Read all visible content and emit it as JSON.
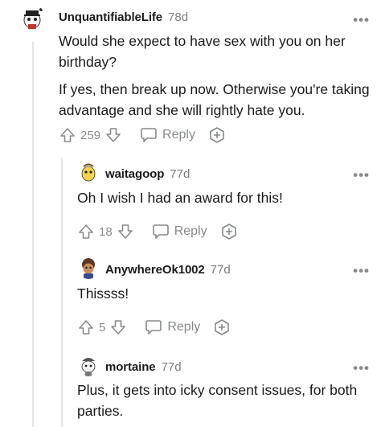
{
  "comments": [
    {
      "username": "UnquantifiableLife",
      "age": "78d",
      "paragraphs": [
        "Would she expect to have sex with you on her birthday?",
        "If yes, then break up now. Otherwise you're taking advantage and she will rightly hate you."
      ],
      "score": "259",
      "reply_label": "Reply",
      "more_label": "•••"
    },
    {
      "username": "waitagoop",
      "age": "77d",
      "paragraphs": [
        "Oh I wish I had an award for this!"
      ],
      "score": "18",
      "reply_label": "Reply",
      "more_label": "•••"
    },
    {
      "username": "AnywhereOk1002",
      "age": "77d",
      "paragraphs": [
        "Thissss!"
      ],
      "score": "5",
      "reply_label": "Reply",
      "more_label": "•••"
    },
    {
      "username": "mortaine",
      "age": "77d",
      "paragraphs": [
        "Plus, it gets into icky consent issues, for both parties."
      ],
      "more_label": "•••"
    }
  ],
  "icons": {
    "upvote": "upvote-arrow-icon",
    "downvote": "downvote-arrow-icon",
    "reply": "speech-bubble-icon",
    "award": "award-plus-icon",
    "more": "more-options-icon"
  },
  "colors": {
    "text": "#1a1a1b",
    "meta": "#878a8c",
    "thread_line": "#e5e5e5"
  }
}
